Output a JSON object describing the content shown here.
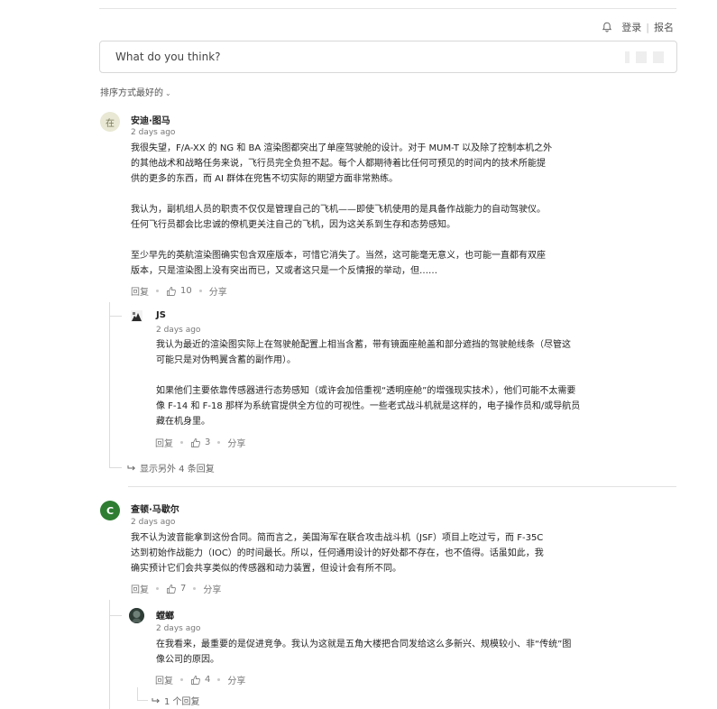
{
  "header": {
    "login": "登录",
    "register": "报名"
  },
  "compose": {
    "placeholder": "What do you think?"
  },
  "sort": {
    "label": "排序方式最好的"
  },
  "comments": [
    {
      "avatar_text": "在",
      "author": "安迪·图马",
      "time": "2 days ago",
      "paragraphs": [
        [
          "我很失望，F/A-XX 的 NG 和 BA 渲染图都突出了单座驾驶舱的设计。对于 MUM-T 以及除了控制本机之外",
          "的其他战术和战略任务来说，飞行员完全负担不起。每个人都期待着比任何可预见的时间内的技术所能提",
          "供的更多的东西，而 AI 群体在兜售不切实际的期望方面非常熟练。"
        ],
        [
          "我认为，副机组人员的职责不仅仅是管理自己的飞机——即使飞机使用的是具备作战能力的自动驾驶仪。",
          "任何飞行员都会比忠诚的僚机更关注自己的飞机，因为这关系到生存和态势感知。"
        ],
        [
          "至少早先的英航渲染图确实包含双座版本，可惜它消失了。当然，这可能毫无意义，也可能一直都有双座",
          "版本，只是渲染图上没有突出而已，又或者这只是一个反情报的举动，但……"
        ]
      ],
      "reply_label": "回复",
      "likes": "10",
      "share_label": "分享",
      "replies": [
        {
          "author": "JS",
          "time": "2 days ago",
          "paragraphs": [
            [
              "我认为最近的渲染图实际上在驾驶舱配置上相当含蓄，带有镜面座舱盖和部分遮挡的驾驶舱线条（尽管这",
              "可能只是对伪鸭翼含蓄的副作用）。"
            ],
            [
              "如果他们主要依靠传感器进行态势感知（或许会加倍重视“透明座舱”的增强现实技术），他们可能不太需要",
              "像 F-14 和 F-18 那样为系统官提供全方位的可视性。一些老式战斗机就是这样的，电子操作员和/或导航员",
              "藏在机身里。"
            ]
          ],
          "reply_label": "回复",
          "likes": "3",
          "share_label": "分享"
        }
      ],
      "more_replies": "显示另外 4 条回复"
    },
    {
      "avatar_text": "C",
      "author": "查顿·马歇尔",
      "time": "2 days ago",
      "paragraphs": [
        [
          "我不认为波音能拿到这份合同。简而言之，美国海军在联合攻击战斗机（JSF）项目上吃过亏，而 F-35C",
          "达到初始作战能力（IOC）的时间最长。所以，任何通用设计的好处都不存在，也不值得。话虽如此，我",
          "确实预计它们会共享类似的传感器和动力装置，但设计会有所不同。"
        ]
      ],
      "reply_label": "回复",
      "likes": "7",
      "share_label": "分享",
      "replies": [
        {
          "author": "螳螂",
          "time": "2 days ago",
          "paragraphs": [
            [
              "在我看来，最重要的是促进竞争。我认为这就是五角大楼把合同发给这么多新兴、规模较小、非“传统”图",
              "像公司的原因。"
            ]
          ],
          "reply_label": "回复",
          "likes": "4",
          "share_label": "分享"
        }
      ],
      "more_replies": "1 个回复"
    }
  ]
}
